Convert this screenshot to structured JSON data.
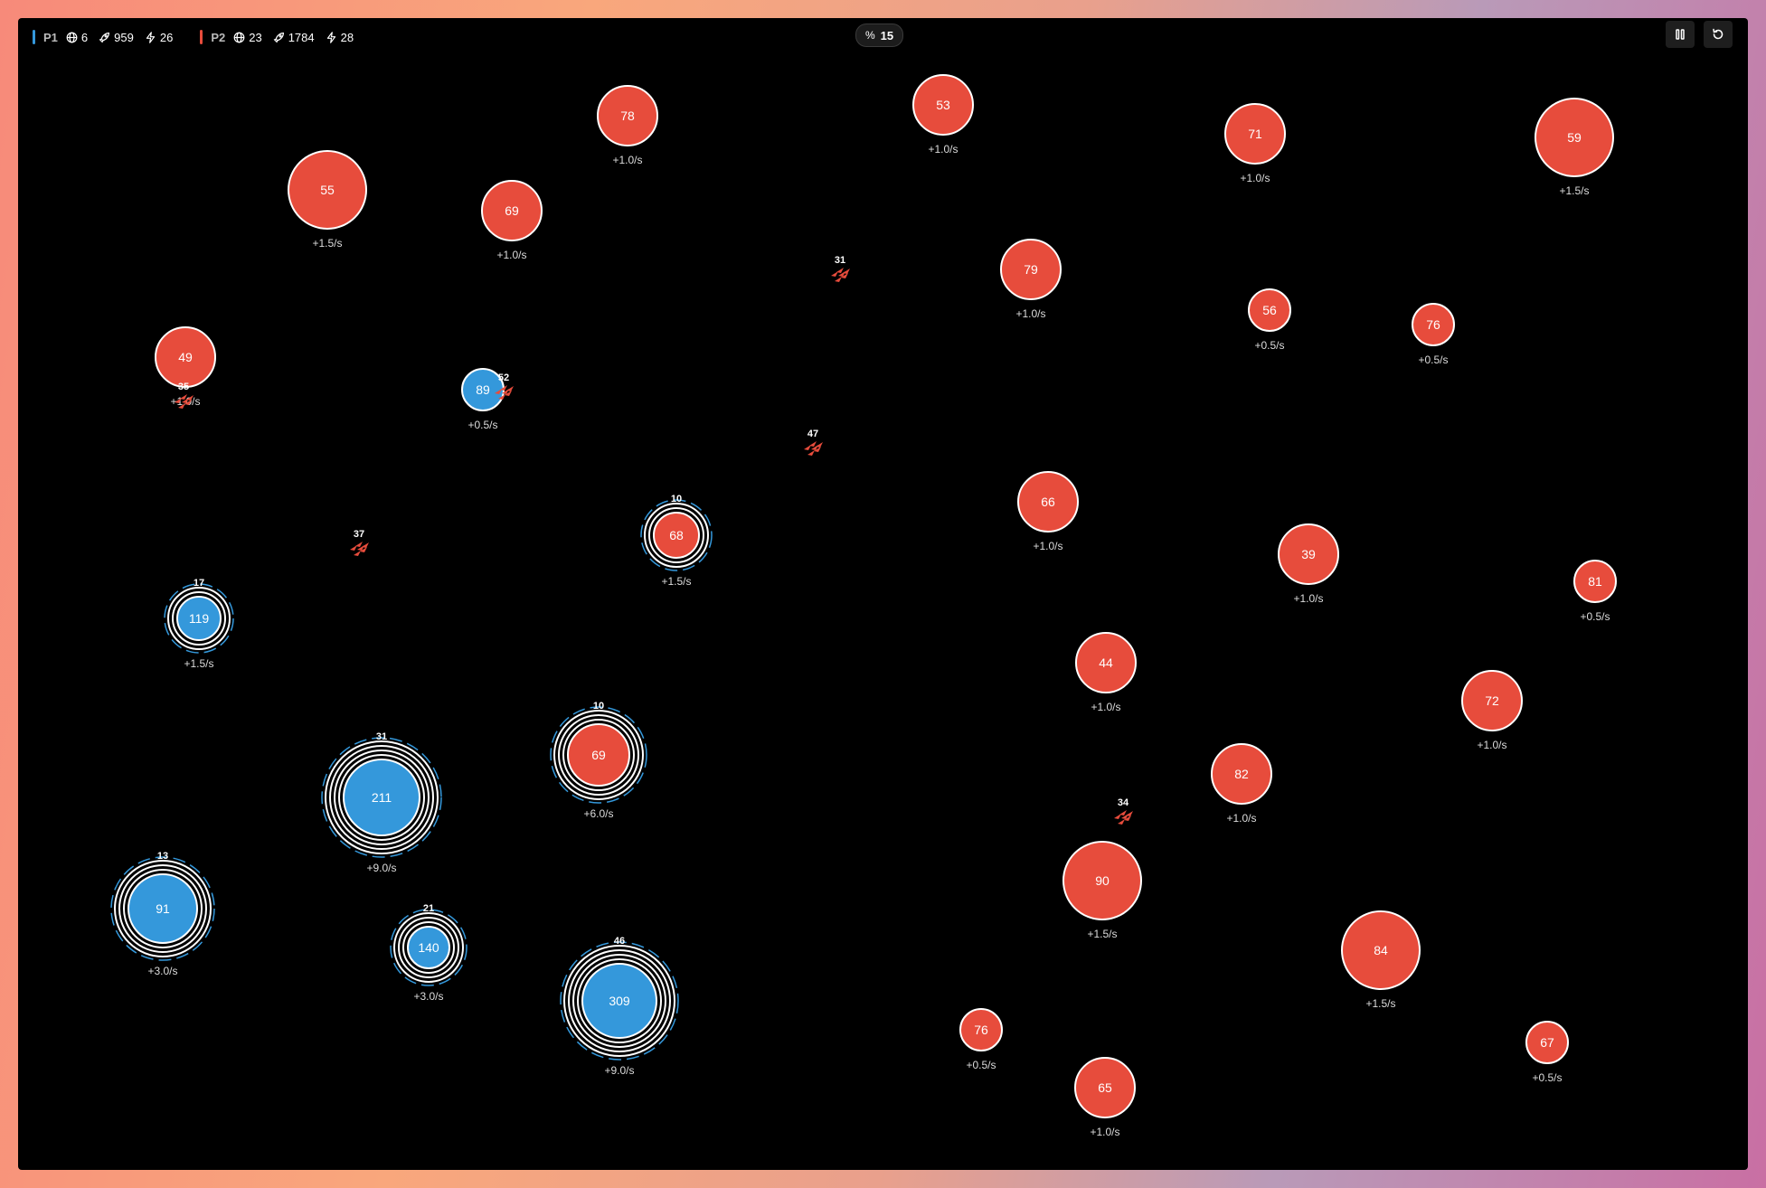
{
  "hud": {
    "players": [
      {
        "name": "P1",
        "color": "#3498db",
        "planets": "6",
        "ships": "959",
        "power": "26"
      },
      {
        "name": "P2",
        "color": "#e74c3c",
        "planets": "23",
        "ships": "1784",
        "power": "28"
      }
    ],
    "send_percent": "15",
    "controls": [
      "pause-icon",
      "restart-icon"
    ]
  },
  "colors": {
    "p1": "#3498db",
    "p2": "#e74c3c",
    "board": "#000000"
  },
  "planets": [
    {
      "owner": "p2",
      "units": "78",
      "rate": "+1.0/s"
    },
    {
      "owner": "p2",
      "units": "53",
      "rate": "+1.0/s"
    },
    {
      "owner": "p2",
      "units": "71",
      "rate": "+1.0/s"
    },
    {
      "owner": "p2",
      "units": "59",
      "rate": "+1.5/s"
    },
    {
      "owner": "p2",
      "units": "55",
      "rate": "+1.5/s"
    },
    {
      "owner": "p2",
      "units": "69",
      "rate": "+1.0/s"
    },
    {
      "owner": "p2",
      "units": "79",
      "rate": "+1.0/s"
    },
    {
      "owner": "p2",
      "units": "56",
      "rate": "+0.5/s"
    },
    {
      "owner": "p2",
      "units": "76",
      "rate": "+0.5/s"
    },
    {
      "owner": "p2",
      "units": "49",
      "rate": "+1.0/s"
    },
    {
      "owner": "p1",
      "units": "89",
      "rate": "+0.5/s"
    },
    {
      "owner": "p2",
      "units": "66",
      "rate": "+1.0/s"
    },
    {
      "owner": "p2",
      "units": "68",
      "rate": "+1.5/s",
      "shield": "10"
    },
    {
      "owner": "p2",
      "units": "39",
      "rate": "+1.0/s"
    },
    {
      "owner": "p2",
      "units": "81",
      "rate": "+0.5/s"
    },
    {
      "owner": "p1",
      "units": "119",
      "rate": "+1.5/s",
      "shield": "17"
    },
    {
      "owner": "p2",
      "units": "44",
      "rate": "+1.0/s"
    },
    {
      "owner": "p2",
      "units": "72",
      "rate": "+1.0/s"
    },
    {
      "owner": "p2",
      "units": "69",
      "rate": "+6.0/s",
      "shield": "10"
    },
    {
      "owner": "p1",
      "units": "211",
      "rate": "+9.0/s",
      "shield": "31"
    },
    {
      "owner": "p2",
      "units": "82",
      "rate": "+1.0/s"
    },
    {
      "owner": "p2",
      "units": "90",
      "rate": "+1.5/s"
    },
    {
      "owner": "p1",
      "units": "91",
      "rate": "+3.0/s",
      "shield": "13"
    },
    {
      "owner": "p1",
      "units": "140",
      "rate": "+3.0/s",
      "shield": "21"
    },
    {
      "owner": "p2",
      "units": "84",
      "rate": "+1.5/s"
    },
    {
      "owner": "p1",
      "units": "309",
      "rate": "+9.0/s",
      "shield": "46"
    },
    {
      "owner": "p2",
      "units": "76",
      "rate": "+0.5/s"
    },
    {
      "owner": "p2",
      "units": "67",
      "rate": "+0.5/s"
    },
    {
      "owner": "p2",
      "units": "65",
      "rate": "+1.0/s"
    }
  ],
  "fleets": [
    {
      "owner": "p2",
      "units": "31"
    },
    {
      "owner": "p2",
      "units": "52"
    },
    {
      "owner": "p2",
      "units": "35"
    },
    {
      "owner": "p2",
      "units": "47"
    },
    {
      "owner": "p2",
      "units": "37"
    },
    {
      "owner": "p2",
      "units": "34"
    }
  ]
}
